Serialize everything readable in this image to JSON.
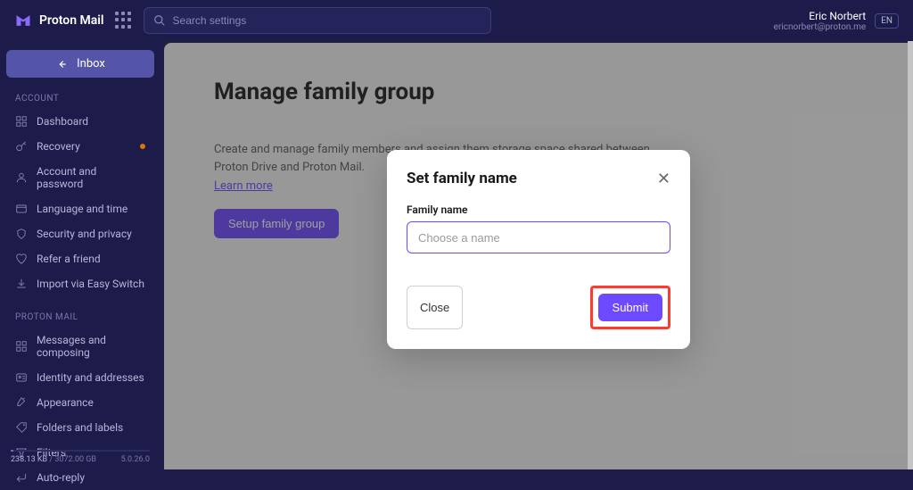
{
  "header": {
    "product_name": "Proton Mail",
    "search_placeholder": "Search settings",
    "user": {
      "name": "Eric Norbert",
      "email": "ericnorbert@proton.me"
    },
    "language": "EN"
  },
  "sidebar": {
    "inbox_label": "Inbox",
    "sections": {
      "account": {
        "label": "Account",
        "items": [
          {
            "label": "Dashboard",
            "icon": "grid"
          },
          {
            "label": "Recovery",
            "icon": "key",
            "dot": true
          },
          {
            "label": "Account and password",
            "icon": "user"
          },
          {
            "label": "Language and time",
            "icon": "globe"
          },
          {
            "label": "Security and privacy",
            "icon": "shield"
          },
          {
            "label": "Refer a friend",
            "icon": "heart"
          },
          {
            "label": "Import via Easy Switch",
            "icon": "download"
          }
        ]
      },
      "mail": {
        "label": "Proton Mail",
        "items": [
          {
            "label": "Messages and composing",
            "icon": "grid"
          },
          {
            "label": "Identity and addresses",
            "icon": "id"
          },
          {
            "label": "Appearance",
            "icon": "paint"
          },
          {
            "label": "Folders and labels",
            "icon": "tag"
          },
          {
            "label": "Filters",
            "icon": "filter"
          },
          {
            "label": "Auto-reply",
            "icon": "reply"
          }
        ]
      }
    },
    "storage": {
      "used": "238.13 KB",
      "divider": " / ",
      "total": "3072.00 GB",
      "version": "5.0.26.0"
    }
  },
  "page": {
    "title": "Manage family group",
    "description": "Create and manage family members and assign them storage space shared between Proton Drive and Proton Mail.",
    "learn_more": "Learn more",
    "setup_button": "Setup family group"
  },
  "modal": {
    "title": "Set family name",
    "field_label": "Family name",
    "placeholder": "Choose a name",
    "close_button": "Close",
    "submit_button": "Submit"
  }
}
